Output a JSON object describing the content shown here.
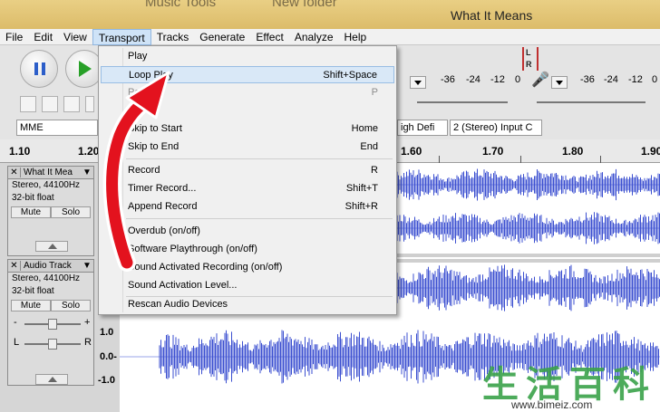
{
  "window": {
    "title": "What It Means",
    "bg_tab_1": "Music Tools",
    "bg_tab_2": "New folder"
  },
  "menubar": [
    "File",
    "Edit",
    "View",
    "Transport",
    "Tracks",
    "Generate",
    "Effect",
    "Analyze",
    "Help"
  ],
  "toolbar": {
    "meter_left": [
      "-36",
      "-24",
      "-12",
      "0"
    ],
    "meter_right": [
      "-36",
      "-24",
      "-12",
      "0"
    ],
    "channel_l": "L",
    "channel_r": "R",
    "host": "MME",
    "quality": "igh Defi",
    "input_channels": "2 (Stereo) Input C"
  },
  "ruler": [
    "1.10",
    "1.20",
    "1.60",
    "1.70",
    "1.80",
    "1.90"
  ],
  "tracks": [
    {
      "name": "What It Mea",
      "format": "Stereo, 44100Hz",
      "depth": "32-bit float",
      "mute": "Mute",
      "solo": "Solo"
    },
    {
      "name": "Audio Track",
      "format": "Stereo, 44100Hz",
      "depth": "32-bit float",
      "mute": "Mute",
      "solo": "Solo",
      "gain_minus": "-",
      "gain_plus": "+",
      "pan_l": "L",
      "pan_r": "R",
      "scale": [
        "1.0",
        "0.0-",
        "-1.0"
      ]
    }
  ],
  "transport_menu": [
    {
      "label": "Play",
      "shortcut": ""
    },
    {
      "label": "Loop Play",
      "shortcut": "Shift+Space",
      "highlighted": true
    },
    {
      "label": "Pause",
      "shortcut": "P",
      "disabled": true
    },
    {
      "label": "S",
      "shortcut": ""
    },
    {
      "label": "Skip to Start",
      "shortcut": "Home"
    },
    {
      "label": "Skip to End",
      "shortcut": "End"
    },
    {
      "label": "Record",
      "shortcut": "R"
    },
    {
      "label": "Timer Record...",
      "shortcut": "Shift+T"
    },
    {
      "label": "Append Record",
      "shortcut": "Shift+R"
    },
    {
      "label": "Overdub (on/off)",
      "shortcut": "",
      "checked": true
    },
    {
      "label": "Software Playthrough (on/off)",
      "shortcut": ""
    },
    {
      "label": "Sound Activated Recording (on/off)",
      "shortcut": ""
    },
    {
      "label": "Sound Activation Level...",
      "shortcut": ""
    },
    {
      "label": "Rescan Audio Devices",
      "shortcut": ""
    }
  ],
  "watermark": {
    "chars": "生活百科",
    "url": "www.bimeiz.com"
  },
  "colors": {
    "waveform": "#3b4fd0",
    "arrow": "#e3121e",
    "menu_highlight": "#d9e8f7",
    "title_bar": "#e2c474"
  }
}
